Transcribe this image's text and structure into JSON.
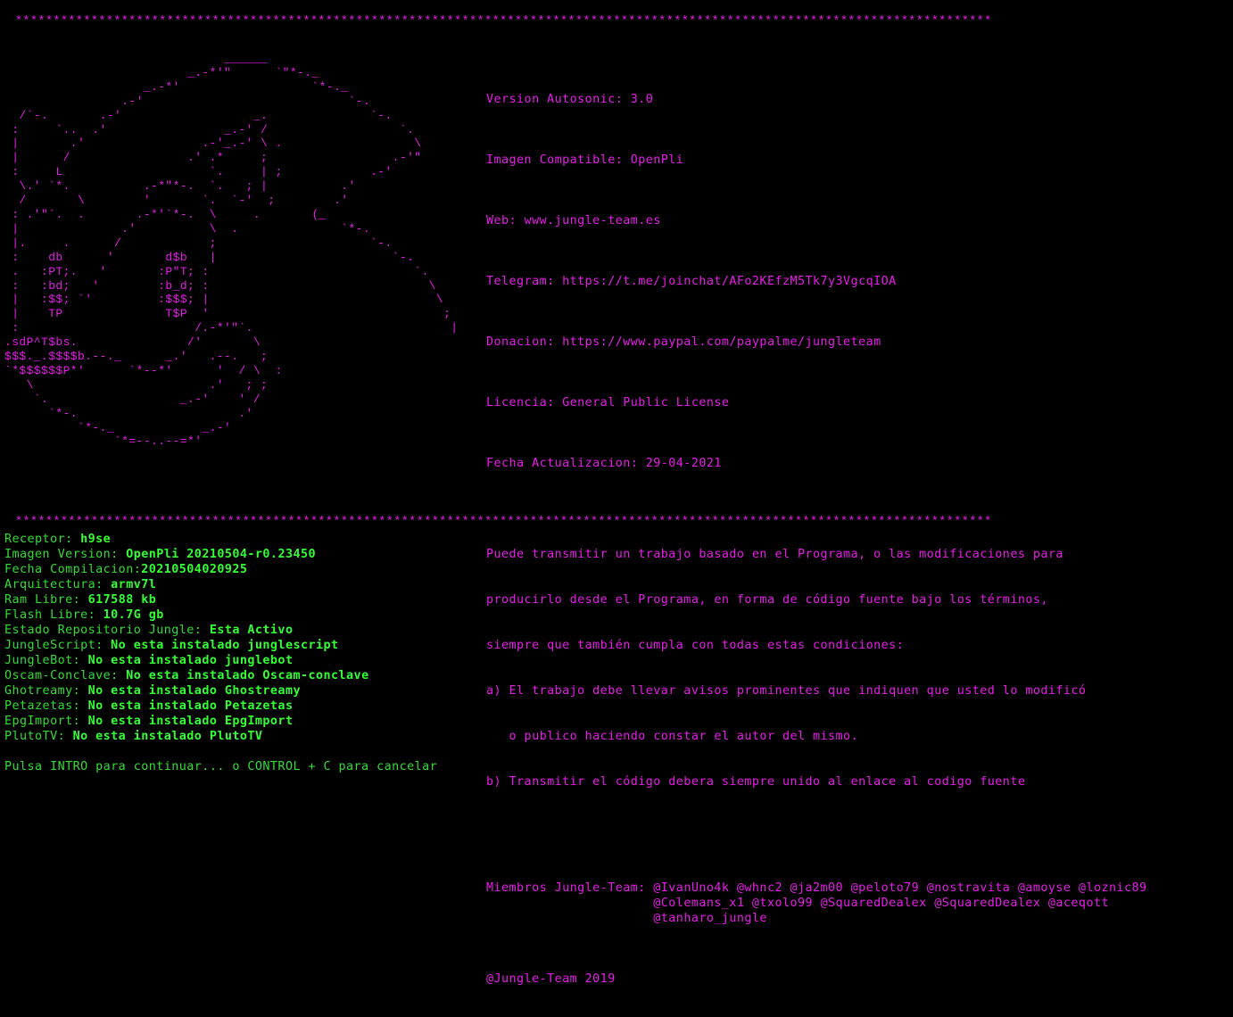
{
  "colors": {
    "background": "#000000",
    "accent_magenta": "#e81ce8",
    "status_green": "#33dd33"
  },
  "separator": "*********************************************************************************************************************************",
  "ascii_art": [
    "                              ______",
    "                         _.-*'\"      `\"*-._",
    "                   _.-*'                  `*-._",
    "                .-'                            `-.",
    "  /`-.       .-'                  _.              `-.",
    " :     `..  .'                _.-' /                  `.",
    " |       .'                .-'_.-' \\ .                  \\",
    " |      /                .' .*     ;                 .-'\"",
    " :     L                    `.     | ;            .-'",
    "  \\.' `*.          .-*\"*-.  `.   ; |          .'",
    "  /       \\        '       `.  `-'  ;        .'",
    " : .'\"`.  .       .-*'`*-.  \\     .       (_",
    " |              .'          \\  .              `*-.",
    " |.     .      /            ;                     `-.",
    " :    db      '       d$b   |                        `-.",
    " .   :PT;.   '       :P\"T; :                            `.",
    " :   :bd;   '        :b_d; :                              \\",
    " |   :$$; `'         :$$$; |                               \\",
    " |    TP              T$P  '                                ;",
    " :                        /.-*'\"`.                           |",
    ".sdP^T$bs.               /'       \\",
    "$$$._.$$$$b.--._      _.'   .--.   ;",
    "`*$$$$$$P*'      `*--*'      '  / \\  :",
    "   \\                        .'   ; ;",
    "    `.                  _.-'    ' /",
    "      `*-.                      .'",
    "          `*-._            _.-'",
    "               `*=--..--=*'"
  ],
  "info": {
    "version": "Version Autosonic: 3.0",
    "image": "Imagen Compatible: OpenPli",
    "web": "Web: www.jungle-team.es",
    "telegram": "Telegram: https://t.me/joinchat/AFo2KEfzM5Tk7y3VgcqIOA",
    "donation": "Donacion: https://www.paypal.com/paypalme/jungleteam",
    "license": "Licencia: General Public License",
    "update_date": "Fecha Actualizacion: 29-04-2021",
    "license_text": [
      "Puede transmitir un trabajo basado en el Programa, o las modificaciones para",
      "producirlo desde el Programa, en forma de código fuente bajo los términos,",
      "siempre que también cumpla con todas estas condiciones:",
      "a) El trabajo debe llevar avisos prominentes que indiquen que usted lo modificó",
      "   o publico haciendo constar el autor del mismo.",
      "b) Transmitir el código debera siempre unido al enlace al codigo fuente"
    ],
    "members_label": "Miembros Jungle-Team: ",
    "members_lines": [
      "@IvanUno4k @whnc2 @ja2m00 @peloto79 @nostravita @amoyse @loznic89",
      "@Colemans_x1 @txolo99 @SquaredDealex @SquaredDealex @aceqott",
      "@tanharo_jungle"
    ],
    "credit": "@Jungle-Team 2019"
  },
  "status": [
    {
      "label": "Receptor: ",
      "value": "h9se"
    },
    {
      "label": "Imagen Version: ",
      "value": "OpenPli 20210504-r0.23450"
    },
    {
      "label": "Fecha Compilacion:",
      "value": "20210504020925"
    },
    {
      "label": "Arquitectura: ",
      "value": "armv7l"
    },
    {
      "label": "Ram Libre: ",
      "value": "617588 kb"
    },
    {
      "label": "Flash Libre: ",
      "value": "10.7G gb"
    },
    {
      "label": "Estado Repositorio Jungle: ",
      "value": "Esta Activo"
    },
    {
      "label": "JungleScript: ",
      "value": "No esta instalado junglescript"
    },
    {
      "label": "JungleBot: ",
      "value": "No esta instalado junglebot"
    },
    {
      "label": "Oscam-Conclave: ",
      "value": "No esta instalado Oscam-conclave"
    },
    {
      "label": "Ghotreamy: ",
      "value": "No esta instalado Ghostreamy"
    },
    {
      "label": "Petazetas: ",
      "value": "No esta instalado Petazetas"
    },
    {
      "label": "EpgImport: ",
      "value": "No esta instalado EpgImport"
    },
    {
      "label": "PlutoTV: ",
      "value": "No esta instalado PlutoTV"
    }
  ],
  "prompt": "Pulsa INTRO para continuar... o CONTROL + C para cancelar"
}
